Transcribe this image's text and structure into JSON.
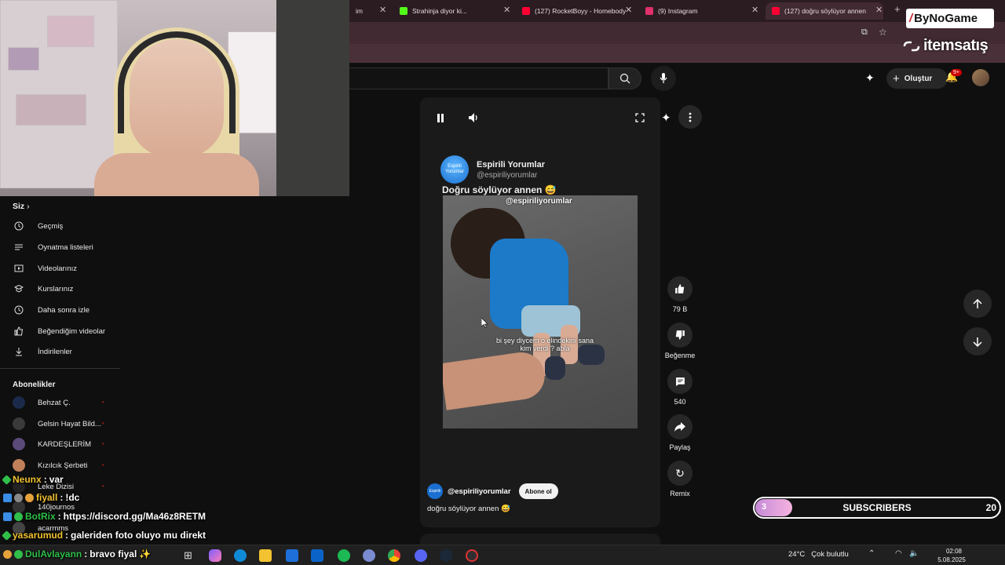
{
  "tabs": [
    {
      "label": "im",
      "color": "#444"
    },
    {
      "label": "Strahinja diyor ki...",
      "color": "#53fc18"
    },
    {
      "label": "(127) RocketBoyy - Homebody",
      "color": "#ff0033"
    },
    {
      "label": "(9) Instagram",
      "color": "#e1306c"
    },
    {
      "label": "(127) doğru söylüyor annen",
      "color": "#ff0033"
    }
  ],
  "topbar": {
    "create_label": "Oluştur",
    "notif_count": "9+"
  },
  "sidebar": {
    "you_label": "Siz",
    "items": [
      {
        "label": "Geçmiş",
        "icon": "history-icon"
      },
      {
        "label": "Oynatma listeleri",
        "icon": "playlist-icon"
      },
      {
        "label": "Videolarınız",
        "icon": "your-videos-icon"
      },
      {
        "label": "Kurslarınız",
        "icon": "courses-icon"
      },
      {
        "label": "Daha sonra izle",
        "icon": "watch-later-icon"
      },
      {
        "label": "Beğendiğim videolar",
        "icon": "liked-icon"
      },
      {
        "label": "İndirilenler",
        "icon": "download-icon"
      }
    ],
    "subs_label": "Abonelikler",
    "subscriptions": [
      {
        "label": "Behzat Ç.",
        "color": "#1b2a4a"
      },
      {
        "label": "Gelsin Hayat Bild...",
        "color": "#3a3a3a"
      },
      {
        "label": "KARDEŞLERİM",
        "color": "#5a4a7a"
      },
      {
        "label": "Kızılcık Şerbeti",
        "color": "#c0805a"
      },
      {
        "label": "Leke Dizisi",
        "color": "#222"
      },
      {
        "label": "140journos",
        "color": "#333"
      },
      {
        "label": "acarmms",
        "color": "#444"
      }
    ]
  },
  "chat": [
    {
      "user": "Neunx",
      "msg": "var",
      "color": "#f2c230",
      "badges": [
        "#2fbf4a"
      ]
    },
    {
      "user": "fiyall",
      "msg": "!dc",
      "color": "#f2c230",
      "badges": [
        "#3a8ee6",
        "#888",
        "#e6a23a"
      ]
    },
    {
      "user": "BotRix",
      "msg": "https://discord.gg/Ma46z8RETM",
      "color": "#2fbf4a",
      "badges": [
        "#3a8ee6",
        "#2fbf4a"
      ]
    },
    {
      "user": "yasarumud",
      "msg": "galeriden foto oluyo mu direkt",
      "color": "#f2c230",
      "badges": [
        "#2fbf4a"
      ]
    },
    {
      "user": "DulAvlayann",
      "msg": "bravo fiyal",
      "color": "#2fbf4a",
      "badges": [
        "#e6a23a",
        "#2fbf4a"
      ]
    }
  ],
  "post": {
    "avatar_text": "Espirili Yorumlar",
    "name": "Espirili Yorumlar",
    "handle": "@espiriliyorumlar",
    "text": "Doğru söylüyor annen 😅",
    "video_watermark": "@espiriliyorumlar",
    "video_caption": "bi şey diycem o elindekini sana kim verdi ? abla"
  },
  "channel": {
    "avatar_text": "Espirili",
    "handle": "@espiriliyorumlar",
    "subscribe_label": "Abone ol",
    "description": "doğru söylüyor annen 😅"
  },
  "actions": {
    "like_count": "79 B",
    "dislike_label": "Beğenme",
    "comment_count": "540",
    "share_label": "Paylaş",
    "remix_label": "Remix"
  },
  "overlays": {
    "bynogame": "ByNoGame",
    "itemsatis": "itemsatış"
  },
  "subscriber_goal": {
    "current": "3",
    "label": "SUBSCRIBERS",
    "goal": "20",
    "progress": 0.15
  },
  "taskbar": {
    "weather": "24°C",
    "weather_desc": "Çok bulutlu",
    "time": "02:08",
    "date": "5.08.2025"
  },
  "colors": {
    "accent_red": "#ff0033",
    "background": "#0f0f0f"
  }
}
